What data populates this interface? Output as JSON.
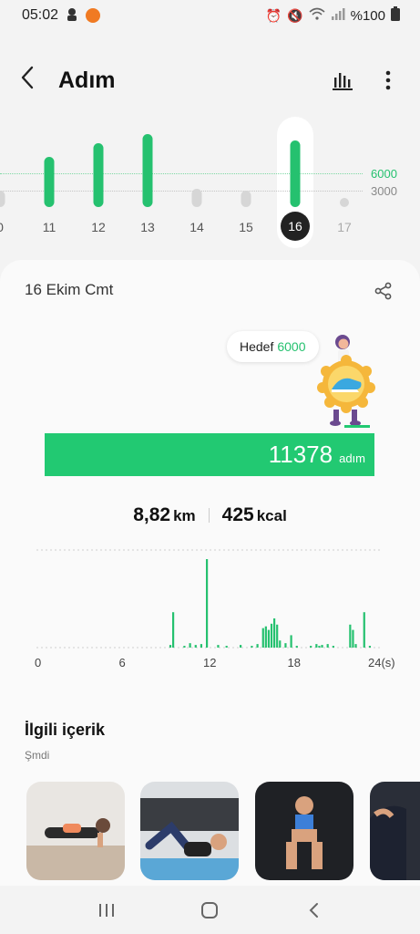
{
  "status_bar": {
    "time": "05:02",
    "battery": "%100"
  },
  "header": {
    "title": "Adım",
    "back_icon": "back-arrow-icon",
    "chart_icon": "bar-chart-icon",
    "more_icon": "more-vertical-icon"
  },
  "week_chart": {
    "goal_label": "6000",
    "base_label": "3000",
    "accent_color": "#25c16f",
    "days": [
      {
        "label": "0",
        "steps": 2000
      },
      {
        "label": "11",
        "steps": 8600
      },
      {
        "label": "12",
        "steps": 10900
      },
      {
        "label": "13",
        "steps": 12500
      },
      {
        "label": "14",
        "steps": 3200
      },
      {
        "label": "15",
        "steps": 2700
      },
      {
        "label": "16",
        "steps": 11378
      },
      {
        "label": "17",
        "steps": 0
      }
    ],
    "selected_day": "16"
  },
  "day_summary": {
    "date": "16 Ekim Cmt",
    "goal_label": "Hedef",
    "goal_value": "6000",
    "steps_value": "11378",
    "steps_unit": "adım",
    "progress_fraction": 1.0,
    "distance_value": "8,82",
    "distance_unit": "km",
    "calories_value": "425",
    "calories_unit": "kcal"
  },
  "chart_data": {
    "type": "bar",
    "title": "",
    "xlabel": "24(s)",
    "ylabel": "",
    "x_ticks": [
      "0",
      "6",
      "12",
      "18",
      "24(s)"
    ],
    "xlim": [
      0,
      24
    ],
    "ylim": [
      0,
      100
    ],
    "grid": true,
    "x": [
      9.4,
      9.6,
      10.4,
      10.8,
      11.2,
      11.6,
      12.0,
      12.8,
      13.4,
      14.4,
      15.2,
      15.6,
      16.0,
      16.2,
      16.4,
      16.6,
      16.8,
      17.0,
      17.2,
      17.6,
      18.0,
      18.4,
      19.4,
      19.8,
      20.0,
      20.2,
      20.6,
      21.0,
      22.2,
      22.4,
      22.6,
      23.2,
      23.6
    ],
    "values": [
      3,
      40,
      2,
      5,
      3,
      4,
      100,
      3,
      2,
      3,
      2,
      4,
      22,
      24,
      20,
      27,
      33,
      26,
      8,
      5,
      14,
      2,
      2,
      4,
      2,
      3,
      4,
      2,
      26,
      20,
      4,
      40,
      2
    ]
  },
  "related": {
    "title": "İlgili içerik",
    "subtitle": "Şmdi",
    "items": [
      {
        "name": "plank"
      },
      {
        "name": "sit-up"
      },
      {
        "name": "squat"
      },
      {
        "name": "arm"
      }
    ]
  },
  "nav": {
    "recent_icon": "recent-apps-icon",
    "home_icon": "home-icon",
    "back_icon": "back-icon"
  }
}
